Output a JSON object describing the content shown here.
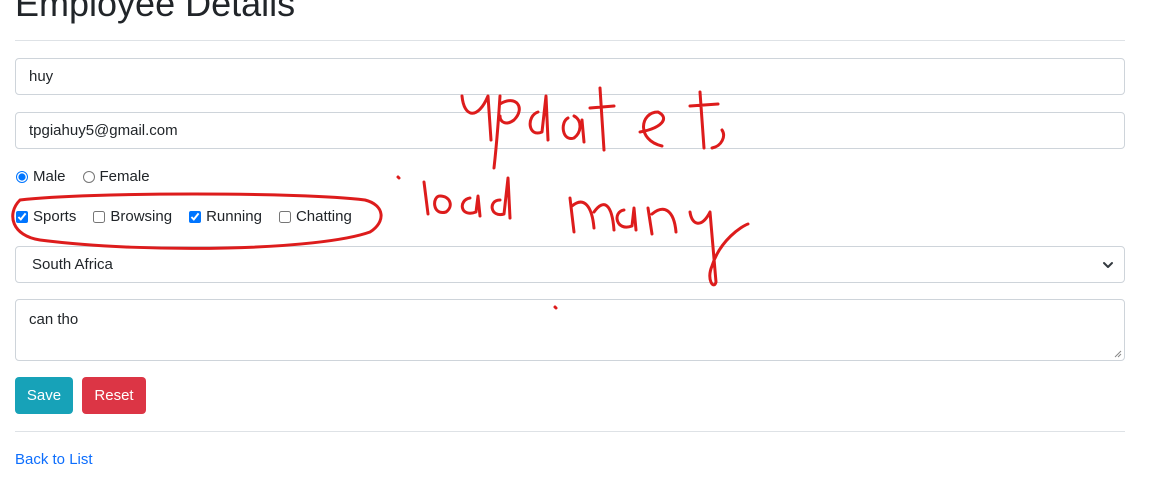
{
  "page": {
    "title": "Employee Details"
  },
  "form": {
    "name_value": "huy",
    "email_value": "tpgiahuy5@gmail.com",
    "gender": {
      "options": [
        {
          "label": "Male",
          "checked": true
        },
        {
          "label": "Female",
          "checked": false
        }
      ]
    },
    "hobbies": [
      {
        "label": "Sports",
        "checked": true
      },
      {
        "label": "Browsing",
        "checked": false
      },
      {
        "label": "Running",
        "checked": true
      },
      {
        "label": "Chatting",
        "checked": false
      }
    ],
    "country_selected": "South Africa",
    "address_value": "can tho"
  },
  "buttons": {
    "save_label": "Save",
    "reset_label": "Reset",
    "save_color": "#17a2b8",
    "reset_color": "#dc3545"
  },
  "footer": {
    "back_link": "Back to List"
  },
  "annotation": {
    "color": "#dd1c1c",
    "handwritten_text": [
      "update",
      "load many"
    ]
  }
}
